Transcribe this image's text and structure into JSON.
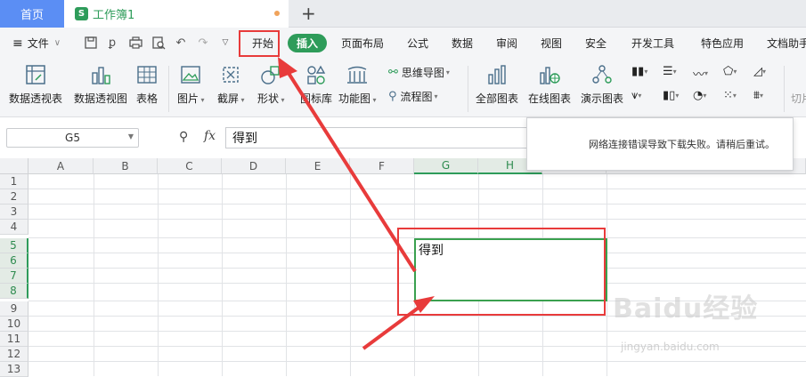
{
  "tabs": {
    "home": "首页",
    "doc_icon": "S",
    "doc": "工作簿1",
    "new_tab": "+"
  },
  "menu": {
    "file": "文件",
    "items": [
      "开始",
      "插入",
      "页面布局",
      "公式",
      "数据",
      "审阅",
      "视图",
      "安全",
      "开发工具",
      "特色应用",
      "文档助手"
    ],
    "active": "插入"
  },
  "ribbon": {
    "pivot_table": "数据透视表",
    "pivot_chart": "数据透视图",
    "table": "表格",
    "picture": "图片",
    "screenshot": "截屏",
    "shapes": "形状",
    "icon_lib": "图标库",
    "func_chart": "功能图",
    "mindmap": "思维导图",
    "flowchart": "流程图",
    "all_charts": "全部图表",
    "online_charts": "在线图表",
    "demo_charts": "演示图表",
    "cut": "切片"
  },
  "formula": {
    "cell_ref": "G5",
    "fx": "fx",
    "content": "得到"
  },
  "toast": "网络连接错误导致下载失败。请稍后重试。",
  "columns": [
    "A",
    "B",
    "C",
    "D",
    "E",
    "F",
    "G",
    "H"
  ],
  "rows": [
    "1",
    "2",
    "3",
    "4",
    "5",
    "6",
    "7",
    "8",
    "9",
    "10",
    "11",
    "12",
    "13"
  ],
  "cell": {
    "ref": "G5",
    "value": "得到"
  },
  "watermark": {
    "main": "Baidu经验",
    "url": "jingyan.baidu.com"
  },
  "colors": {
    "accent": "#2e9c5a",
    "home_tab": "#5b8ef4",
    "annotation": "#e83b3b"
  }
}
